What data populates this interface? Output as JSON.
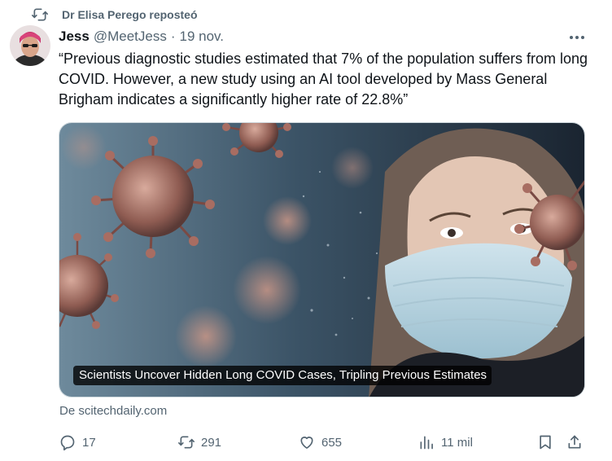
{
  "repost": {
    "text": "Dr Elisa Perego reposteó",
    "icon": "repost-icon"
  },
  "author": {
    "name": "Jess",
    "handle": "@MeetJess",
    "separator": "·",
    "date": "19 nov."
  },
  "tweet": {
    "text": "“Previous diagnostic studies estimated that 7% of the population suffers from long COVID. However, a new study using an AI tool developed by Mass General Brigham indicates a significantly higher rate of 22.8%”"
  },
  "media": {
    "caption": "Scientists Uncover Hidden Long COVID Cases, Tripling Previous Estimates"
  },
  "source": "De scitechdaily.com",
  "actions": {
    "replies": "17",
    "reposts": "291",
    "likes": "655",
    "views": "11 mil"
  },
  "colors": {
    "text": "#0f1419",
    "secondary": "#536471",
    "border": "#cfd9de"
  },
  "icons": [
    "repost-icon",
    "more-icon",
    "reply-icon",
    "like-icon",
    "views-icon",
    "bookmark-icon",
    "share-icon"
  ]
}
